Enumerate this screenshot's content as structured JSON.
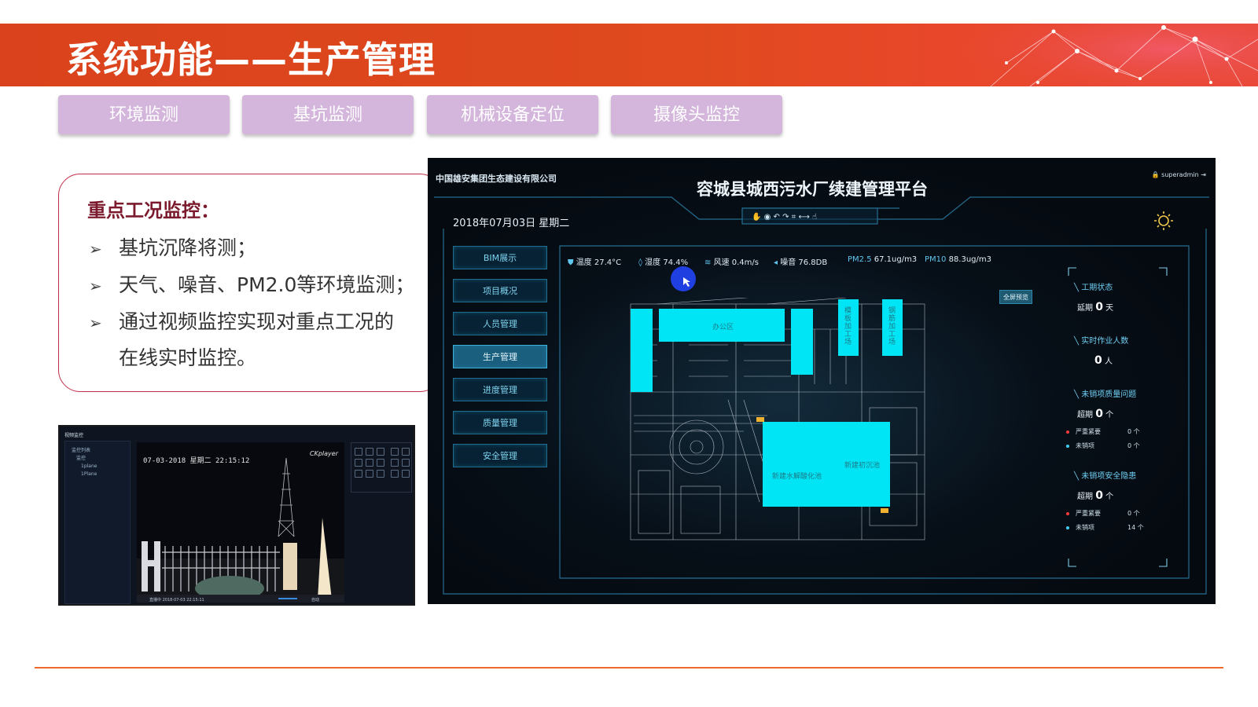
{
  "header": {
    "title": "系统功能——生产管理"
  },
  "tabs": [
    {
      "label": "环境监测"
    },
    {
      "label": "基坑监测"
    },
    {
      "label": "机械设备定位"
    },
    {
      "label": "摄像头监控"
    }
  ],
  "card": {
    "title": "重点工况监控：",
    "bullets": [
      "基坑沉降将测；",
      "天气、噪音、PM2.0等环境监测；",
      "通过视频监控实现对重点工况的",
      "在线实时监控。"
    ]
  },
  "video": {
    "panel_title": "视频监控",
    "tree": [
      "监控列表",
      "监控",
      "1plane",
      "1Plane"
    ],
    "timestamp": "07-03-2018 星期二 22:15:12",
    "player": "CKplayer",
    "status": "直播中 2018-07-03 22:15:11",
    "auto": "自动"
  },
  "dashboard": {
    "company": "中国雄安集团生态建设有限公司",
    "title": "容城县城西污水厂续建管理平台",
    "user": "superadmin",
    "date": "2018年07月03日  星期二",
    "menu": [
      {
        "label": "BIM展示",
        "active": false
      },
      {
        "label": "项目概况",
        "active": false
      },
      {
        "label": "人员管理",
        "active": false
      },
      {
        "label": "生产管理",
        "active": true
      },
      {
        "label": "进度管理",
        "active": false
      },
      {
        "label": "质量管理",
        "active": false
      },
      {
        "label": "安全管理",
        "active": false
      }
    ],
    "env": [
      {
        "k": "温度",
        "v": "27.4°C"
      },
      {
        "k": "湿度",
        "v": "74.4%"
      },
      {
        "k": "风速",
        "v": "0.4m/s"
      },
      {
        "k": "噪音",
        "v": "76.8DB"
      },
      {
        "k": "PM2.5",
        "v": "67.1ug/m3"
      },
      {
        "k": "PM10",
        "v": "88.3ug/m3"
      }
    ],
    "fullscreen": "全屏预览",
    "map_labels": {
      "office": "办公区",
      "shop1": "模板加工场",
      "shop2": "钢筋加工场",
      "pool1": "新建水解酸化池",
      "pool2": "新建初沉池"
    },
    "right": {
      "status_title": "工期状态",
      "status_prefix": "延期",
      "status_value": "0",
      "status_unit": "天",
      "workers_title": "实时作业人数",
      "workers_value": "0",
      "workers_unit": "人",
      "quality_title": "未销项质量问题",
      "quality_prefix": "超期",
      "quality_value": "0",
      "quality_unit": "个",
      "quality_rows": [
        {
          "label": "严重紧要",
          "value": "0 个"
        },
        {
          "label": "未销项",
          "value": "0 个"
        }
      ],
      "safety_title": "未销项安全隐患",
      "safety_prefix": "超期",
      "safety_value": "0",
      "safety_unit": "个",
      "safety_rows": [
        {
          "label": "严重紧要",
          "value": "0 个"
        },
        {
          "label": "未销项",
          "value": "14 个"
        }
      ]
    },
    "colors": {
      "accent": "#00e5f5",
      "red_dot": "#ff3b3b",
      "cyan_dot": "#3fd0f0"
    }
  }
}
